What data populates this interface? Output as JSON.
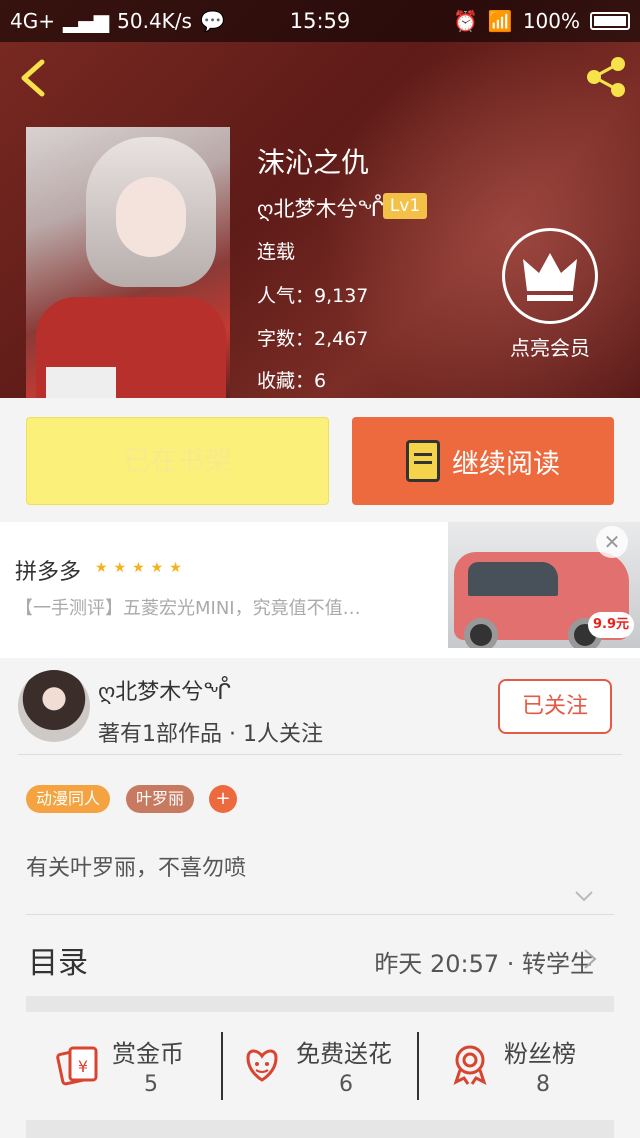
{
  "status_bar": {
    "network": "4G+",
    "speed": "50.4K/s",
    "time": "15:59",
    "battery": "100%"
  },
  "book": {
    "title": "沫沁之仇",
    "author": "ღ北梦木兮ᖎ",
    "level": "Lv1",
    "status": "连载",
    "popularity": "人气：9,137",
    "word_count": "字数：2,467",
    "favorites": "收藏：6"
  },
  "vip": {
    "label": "点亮会员"
  },
  "actions": {
    "shelf_label": "已在书架",
    "read_label": "继续阅读"
  },
  "ad": {
    "title": "拼多多",
    "stars": "★★★★★",
    "description": "【一手测评】五菱宏光MINI，究竟值不值…",
    "price": "9.9元",
    "close": "✕"
  },
  "author_card": {
    "name": "ღ北梦木兮ᖎ",
    "meta": "著有1部作品 · 1人关注",
    "follow_label": "已关注"
  },
  "tags": [
    "动漫同人",
    "叶罗丽",
    "+"
  ],
  "intro": "有关叶罗丽，不喜勿喷",
  "toc": {
    "label": "目录",
    "latest": "昨天 20:57 · 转学生"
  },
  "perks": [
    {
      "label": "赏金币",
      "value": "5",
      "icon": "coin-envelope-icon"
    },
    {
      "label": "免费送花",
      "value": "6",
      "icon": "flower-icon"
    },
    {
      "label": "粉丝榜",
      "value": "8",
      "icon": "ribbon-medal-icon"
    }
  ],
  "colors": {
    "accent": "#ec6a3d",
    "shelf_button": "#fbf07a",
    "level_badge": "#f4c148",
    "share_icon": "#f6e24a"
  }
}
